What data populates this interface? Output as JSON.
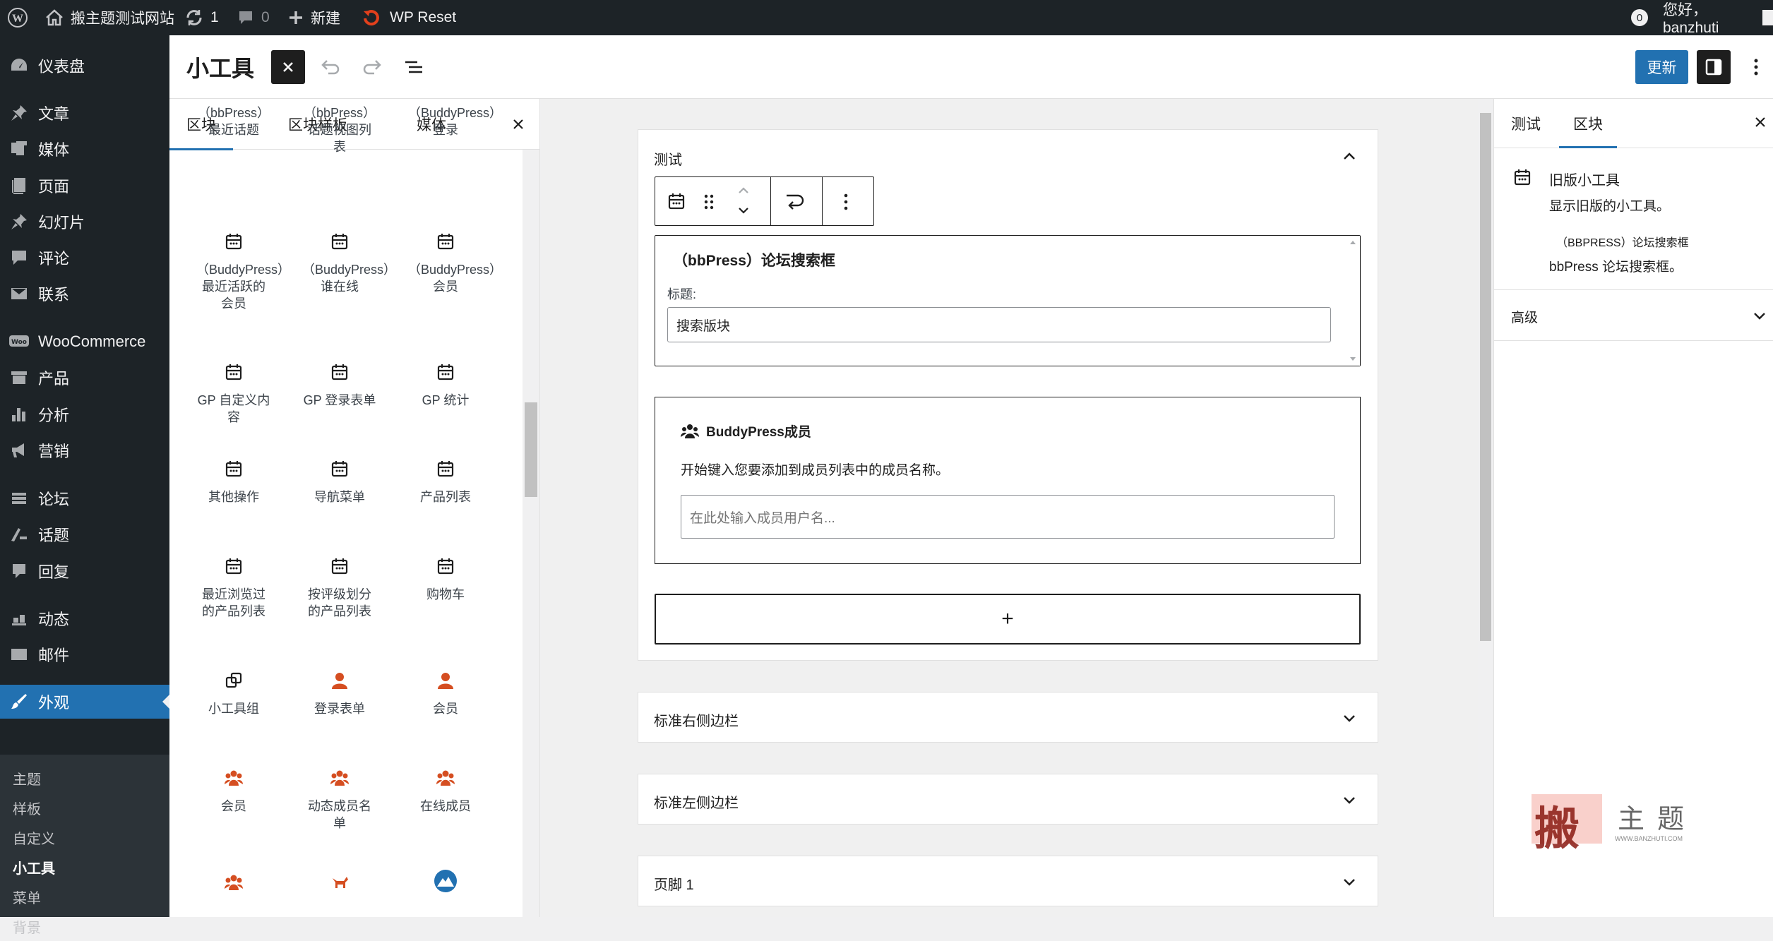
{
  "admin_bar": {
    "site_name": "搬主题测试网站",
    "updates_count": "1",
    "comments_count": "0",
    "new_label": "新建",
    "wp_reset_label": "WP Reset",
    "notification_count": "0",
    "greeting": "您好，banzhuti"
  },
  "admin_menu": {
    "items": [
      {
        "label": "仪表盘",
        "icon": "dashboard-icon"
      },
      {
        "label": "文章",
        "icon": "pin-icon"
      },
      {
        "label": "媒体",
        "icon": "media-icon"
      },
      {
        "label": "页面",
        "icon": "page-icon"
      },
      {
        "label": "幻灯片",
        "icon": "pin-icon"
      },
      {
        "label": "评论",
        "icon": "comment-icon"
      },
      {
        "label": "联系",
        "icon": "mail-icon"
      },
      {
        "label": "WooCommerce",
        "icon": "woo-icon"
      },
      {
        "label": "产品",
        "icon": "archive-icon"
      },
      {
        "label": "分析",
        "icon": "chart-icon"
      },
      {
        "label": "营销",
        "icon": "megaphone-icon"
      },
      {
        "label": "论坛",
        "icon": "forum-icon"
      },
      {
        "label": "话题",
        "icon": "topic-icon"
      },
      {
        "label": "回复",
        "icon": "reply-icon"
      },
      {
        "label": "动态",
        "icon": "activity-icon"
      },
      {
        "label": "邮件",
        "icon": "mail-icon"
      },
      {
        "label": "外观",
        "icon": "brush-icon"
      }
    ],
    "submenu": [
      "主题",
      "样板",
      "自定义",
      "小工具",
      "菜单",
      "背景"
    ]
  },
  "header": {
    "title": "小工具",
    "update_label": "更新"
  },
  "inserter": {
    "tabs": [
      "区块",
      "区块样板",
      "媒体"
    ],
    "blocks": [
      [
        "（bbPress）最近话题",
        "（bbPress）话题视图列表",
        "（BuddyPress）登录"
      ],
      [
        "（BuddyPress）最近活跃的会员",
        "（BuddyPress）谁在线",
        "（BuddyPress）会员"
      ],
      [
        "GP 自定义内容",
        "GP 登录表单",
        "GP 统计"
      ],
      [
        "其他操作",
        "导航菜单",
        "产品列表"
      ],
      [
        "最近浏览过的产品列表",
        "按评级划分的产品列表",
        "购物车"
      ],
      [
        "小工具组",
        "登录表单",
        "会员"
      ],
      [
        "会员",
        "动态成员名单",
        "在线成员"
      ]
    ]
  },
  "canvas": {
    "area_open_title": "测试",
    "legacy_widget_title": "（bbPress）论坛搜索框",
    "legacy_field_label": "标题:",
    "legacy_field_value": "搜索版块",
    "bp_members_title": "BuddyPress成员",
    "bp_members_desc": "开始键入您要添加到成员列表中的成员名称。",
    "bp_members_placeholder": "在此处输入成员用户名...",
    "add_block": "+",
    "areas": [
      "标准右侧边栏",
      "标准左侧边栏",
      "页脚 1"
    ]
  },
  "sidebar": {
    "tabs": [
      "测试",
      "区块"
    ],
    "block_name": "旧版小工具",
    "block_desc": "显示旧版的小工具。",
    "widget_name": "（BBPRESS）论坛搜索框",
    "widget_desc": "bbPress 论坛搜索框。",
    "advanced": "高级"
  },
  "watermark": {
    "brand": "主题",
    "logo_char": "搬",
    "url": "WWW.BANZHUTI.COM"
  }
}
